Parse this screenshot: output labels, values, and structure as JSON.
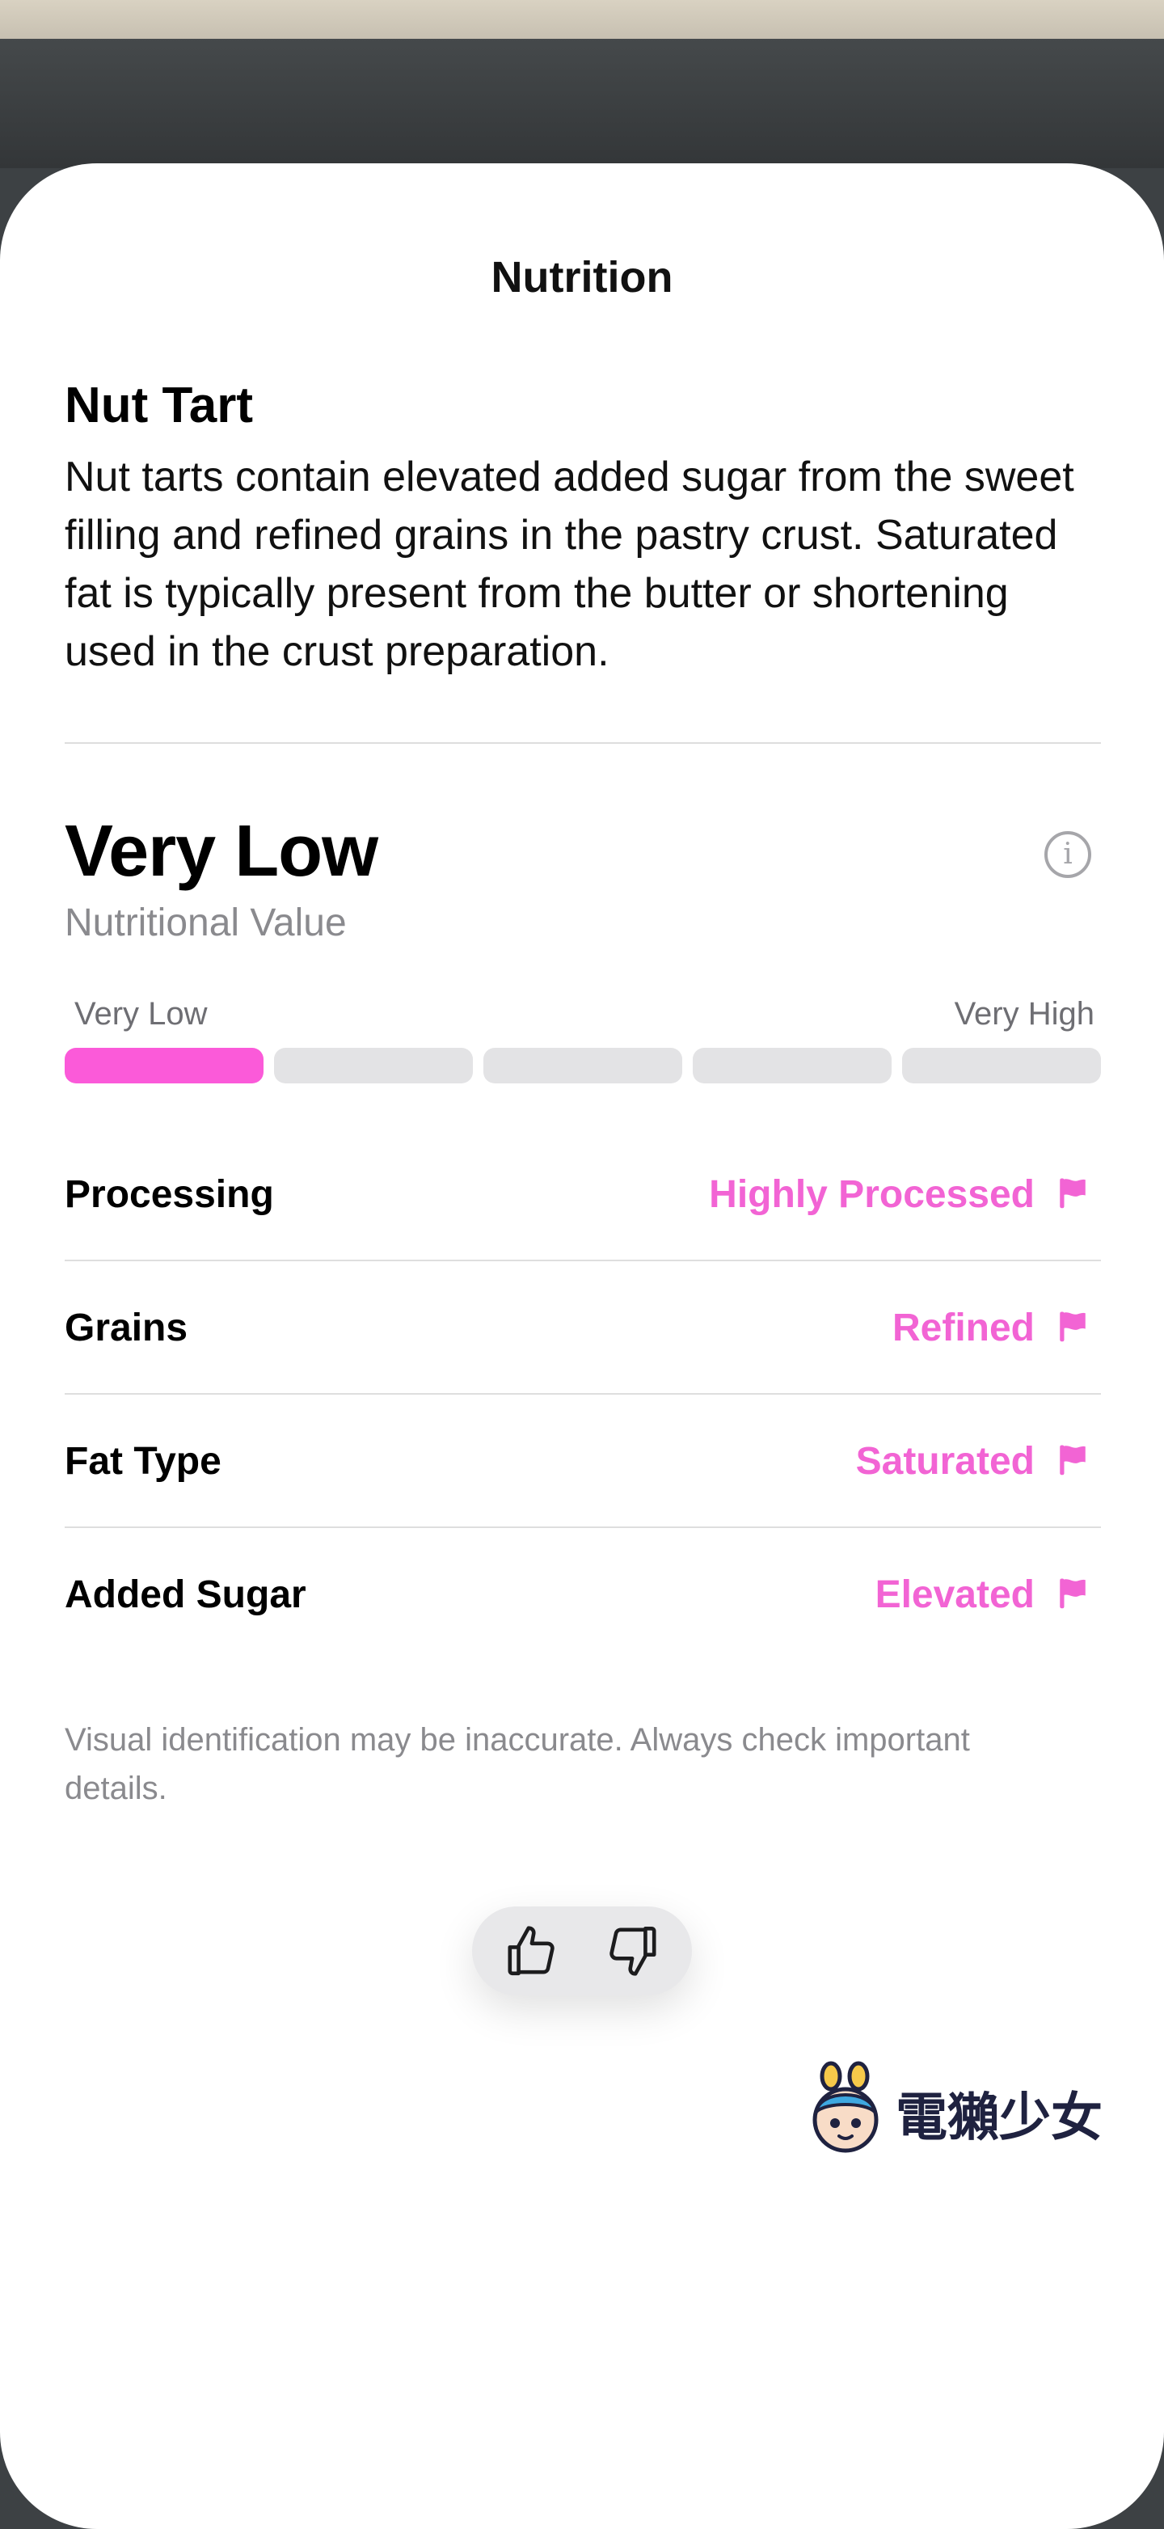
{
  "header": {
    "title": "Nutrition"
  },
  "food": {
    "name": "Nut Tart",
    "description": "Nut tarts contain elevated added sugar from the sweet filling and refined grains in the pastry crust. Saturated fat is typically present from the butter or shortening used in the crust preparation."
  },
  "score": {
    "rating": "Very Low",
    "subtitle": "Nutritional Value",
    "scale_min_label": "Very Low",
    "scale_max_label": "Very High",
    "level": 1,
    "level_count": 5,
    "active_color": "#fb5ad9"
  },
  "attributes": [
    {
      "label": "Processing",
      "value": "Highly Processed",
      "icon": "flag-icon"
    },
    {
      "label": "Grains",
      "value": "Refined",
      "icon": "flag-icon"
    },
    {
      "label": "Fat Type",
      "value": "Saturated",
      "icon": "flag-icon"
    },
    {
      "label": "Added Sugar",
      "value": "Elevated",
      "icon": "flag-icon"
    }
  ],
  "disclaimer": "Visual identification may be inaccurate. Always check important details.",
  "feedback": {
    "up_icon": "thumbs-up-icon",
    "down_icon": "thumbs-down-icon"
  },
  "watermark": {
    "text": "電獺少女"
  },
  "colors": {
    "accent": "#f264d4",
    "sheet": "#ffffff"
  }
}
